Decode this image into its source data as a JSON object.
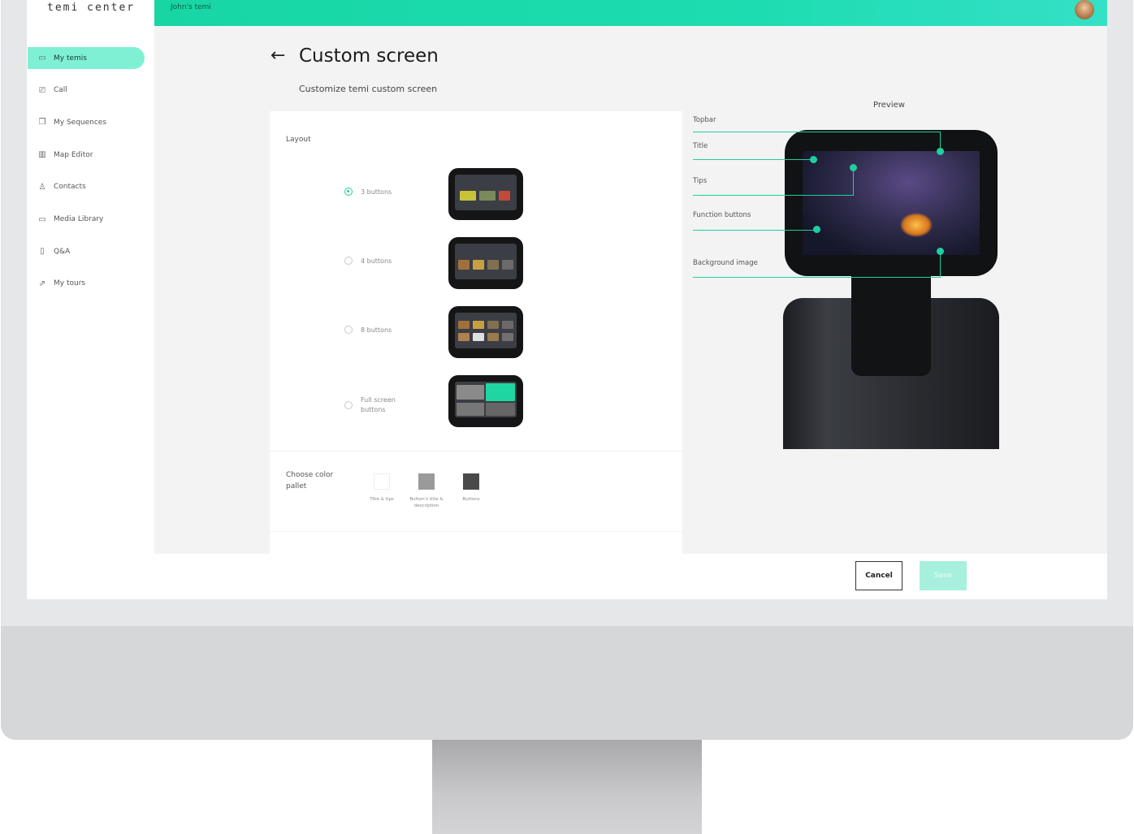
{
  "app": {
    "logo": "temi center",
    "account": "John's temi"
  },
  "sidebar": {
    "items": [
      {
        "label": "My temis",
        "icon": "robot-icon",
        "glyph": "▭",
        "active": true
      },
      {
        "label": "Call",
        "icon": "video-call-icon",
        "glyph": "⎚",
        "active": false
      },
      {
        "label": "My Sequences",
        "icon": "sequence-icon",
        "glyph": "❐",
        "active": false
      },
      {
        "label": "Map Editor",
        "icon": "map-icon",
        "glyph": "▥",
        "active": false
      },
      {
        "label": "Contacts",
        "icon": "person-icon",
        "glyph": "♙",
        "active": false
      },
      {
        "label": "Media Library",
        "icon": "folder-icon",
        "glyph": "▭",
        "active": false
      },
      {
        "label": "Q&A",
        "icon": "qa-icon",
        "glyph": "▯",
        "active": false
      },
      {
        "label": "My tours",
        "icon": "tour-icon",
        "glyph": "⇗",
        "active": false
      }
    ]
  },
  "header": {
    "back_glyph": "←",
    "title": "Custom screen",
    "subtitle": "Customize temi custom screen"
  },
  "layout": {
    "label": "Layout",
    "options": [
      {
        "label": "3 buttons",
        "selected": true
      },
      {
        "label": "4 buttons",
        "selected": false
      },
      {
        "label": "8 buttons",
        "selected": false
      },
      {
        "label": "Full screen buttons",
        "selected": false
      }
    ]
  },
  "palette": {
    "label": "Choose color pallet",
    "swatches": [
      {
        "label": "Title & tips",
        "color": "#ffffff"
      },
      {
        "label": "Button's title & description",
        "color": "#9a9a9a"
      },
      {
        "label": "Buttons",
        "color": "#4a4a4a"
      }
    ]
  },
  "preview": {
    "label": "Preview",
    "labels": [
      "Topbar",
      "Title",
      "Tips",
      "Function buttons",
      "Background image"
    ]
  },
  "actions": {
    "cancel": "Cancel",
    "save": "Save"
  },
  "colors": {
    "accent": "#1fcf9f",
    "topbar": "#18d6a4",
    "active_nav": "#7ff0d3",
    "save_disabled": "#a7f0dd"
  }
}
